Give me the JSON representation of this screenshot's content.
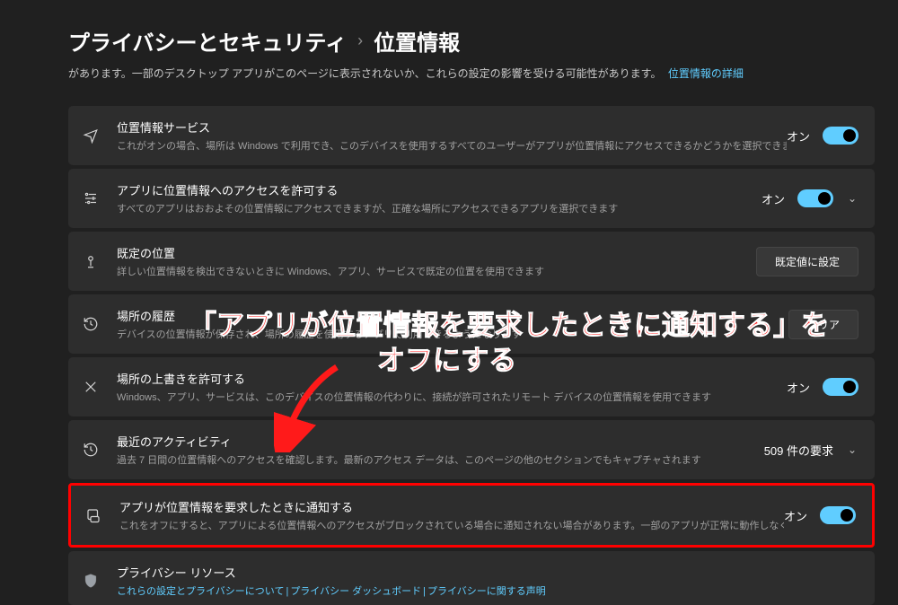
{
  "breadcrumb": {
    "parent": "プライバシーとセキュリティ",
    "current": "位置情報"
  },
  "intro": {
    "text": "があります。一部のデスクトップ アプリがこのページに表示されないか、これらの設定の影響を受ける可能性があります。",
    "link": "位置情報の詳細"
  },
  "rows": {
    "service": {
      "title": "位置情報サービス",
      "desc": "これがオンの場合、場所は Windows で利用でき、このデバイスを使用するすべてのユーザーがアプリが位置情報にアクセスできるかどうかを選択できます",
      "toggle": "オン"
    },
    "allow": {
      "title": "アプリに位置情報へのアクセスを許可する",
      "desc": "すべてのアプリはおおよその位置情報にアクセスできますが、正確な場所にアクセスできるアプリを選択できます",
      "toggle": "オン"
    },
    "default": {
      "title": "既定の位置",
      "desc": "詳しい位置情報を検出できないときに Windows、アプリ、サービスで既定の位置を使用できます",
      "button": "既定値に設定"
    },
    "history": {
      "title": "場所の履歴",
      "desc": "デバイスの位置情報が保存され、場所の履歴を使用するアプリで利用できるようになります",
      "button": "クリア"
    },
    "override": {
      "title": "場所の上書きを許可する",
      "desc": "Windows、アプリ、サービスは、このデバイスの位置情報の代わりに、接続が許可されたリモート デバイスの位置情報を使用できます",
      "toggle": "オン"
    },
    "recent": {
      "title": "最近のアクティビティ",
      "desc": "過去 7 日間の位置情報へのアクセスを確認します。最新のアクセス データは、このページの他のセクションでもキャプチャされます",
      "badge": "509 件の要求"
    },
    "notify": {
      "title": "アプリが位置情報を要求したときに通知する",
      "desc": "これをオフにすると、アプリによる位置情報へのアクセスがブロックされている場合に通知されない場合があります。一部のアプリが正常に動作しなくなる可能性があります。",
      "toggle": "オン"
    },
    "privacy": {
      "title": "プライバシー リソース",
      "link1": "これらの設定とプライバシーについて",
      "link2": "プライバシー ダッシュボード",
      "link3": "プライバシーに関する声明"
    }
  },
  "annotation": {
    "line1": "「アプリが位置情報を要求したときに通知する」を",
    "line2": "オフにする"
  }
}
